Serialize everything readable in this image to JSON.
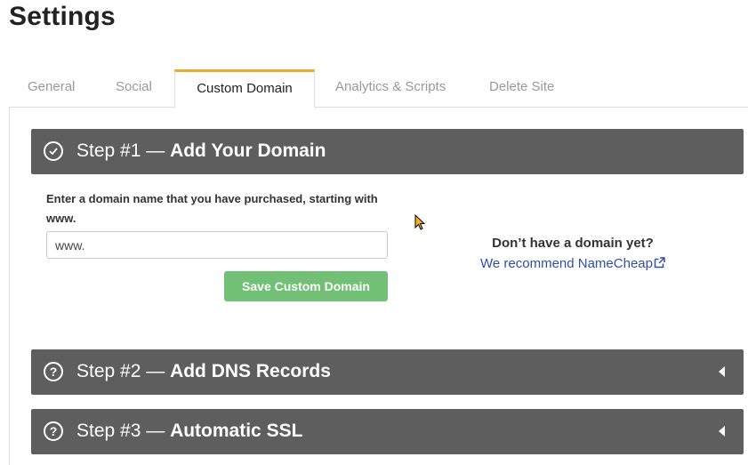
{
  "page": {
    "title": "Settings"
  },
  "tabs": [
    {
      "label": "General",
      "active": false
    },
    {
      "label": "Social",
      "active": false
    },
    {
      "label": "Custom Domain",
      "active": true
    },
    {
      "label": "Analytics & Scripts",
      "active": false
    },
    {
      "label": "Delete Site",
      "active": false
    }
  ],
  "steps": [
    {
      "prefix": "Step #1 — ",
      "title": "Add Your Domain",
      "icon": "check-circle-icon",
      "expanded": true
    },
    {
      "prefix": "Step #2 — ",
      "title": "Add DNS Records",
      "icon": "question-circle-icon",
      "expanded": false
    },
    {
      "prefix": "Step #3 — ",
      "title": "Automatic SSL",
      "icon": "question-circle-icon",
      "expanded": false
    }
  ],
  "form": {
    "label": "Enter a domain name that you have purchased, starting with www.",
    "input_value": "www.",
    "save_label": "Save Custom Domain"
  },
  "aside": {
    "question": "Don’t have a domain yet?",
    "link_text": "We recommend NameCheap"
  },
  "colors": {
    "accent_tab": "#f0a732",
    "step_header_bg": "#5e5e5e",
    "save_button": "#72bf76",
    "link": "#2f4fa8"
  }
}
